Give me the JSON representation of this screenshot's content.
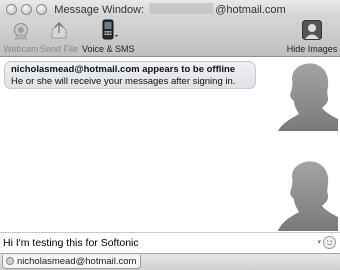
{
  "window": {
    "title_prefix": "Message Window:",
    "title_suffix": "@hotmail.com"
  },
  "toolbar": {
    "webcam_label": "Webcam",
    "send_file_label": "Send File",
    "voice_sms_label": "Voice & SMS",
    "hide_images_label": "Hide Images"
  },
  "conversation": {
    "status_line": "nicholasmead@hotmail.com appears to be offline",
    "info_line": "He or she will receive your messages after signing in."
  },
  "composer": {
    "value": "Hi I'm testing this for Softonic"
  },
  "tabs": [
    {
      "label": "nicholasmead@hotmail.com"
    }
  ],
  "icons": {
    "webcam": "webcam-icon",
    "send_file": "send-file-icon",
    "voice_sms": "phone-icon",
    "hide_images": "person-icon",
    "emoticon": "smiley-icon"
  }
}
